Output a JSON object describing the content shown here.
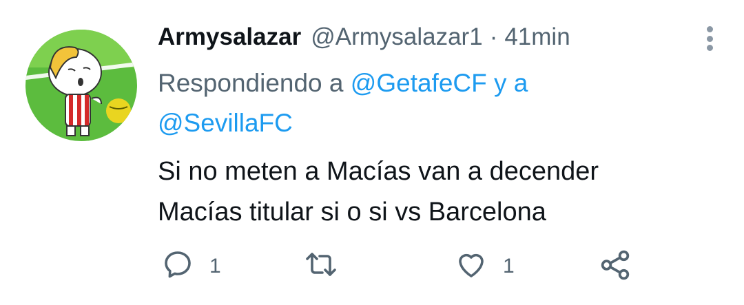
{
  "tweet": {
    "display_name": "Armysalazar",
    "handle": "@Armysalazar1",
    "separator": "·",
    "time": "41min",
    "replying_prefix": "Respondiendo a",
    "mention_1": "@GetafeCF",
    "mention_joiner": "y a",
    "mention_2": "@SevillaFC",
    "body_line_1": "Si no meten a Macías van a decender",
    "body_line_2": "Macías titular si o si vs Barcelona"
  },
  "actions": {
    "reply_count": "1",
    "retweet_count": "",
    "like_count": "1"
  },
  "icons": {
    "reply": "comment-icon",
    "retweet": "retweet-icon",
    "like": "heart-icon",
    "share": "share-icon",
    "more": "more-vertical-icon"
  },
  "colors": {
    "text": "#0f1419",
    "secondary": "#536471",
    "link": "#1d9bf0",
    "avatar_bg": "#4caf3a"
  }
}
